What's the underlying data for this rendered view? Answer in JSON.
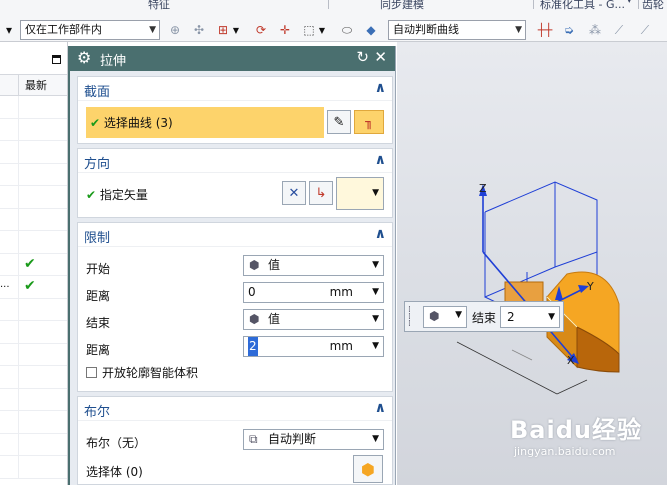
{
  "ribbon": {
    "groups": [
      "特征",
      "同步建模",
      "标准化工具 - G...",
      "齿轮"
    ],
    "filter_dropdown": "仅在工作部件内",
    "curve_rule_dropdown": "自动判断曲线"
  },
  "navigator": {
    "column_header": "最新",
    "rows": [
      {
        "label": "",
        "latest": false
      },
      {
        "label": "",
        "latest": false
      },
      {
        "label": "",
        "latest": false
      },
      {
        "label": "",
        "latest": false
      },
      {
        "label": "",
        "latest": false
      },
      {
        "label": "",
        "latest": false
      },
      {
        "label": "",
        "latest": false
      },
      {
        "label": "",
        "latest": true
      },
      {
        "label": "...",
        "latest": true
      },
      {
        "label": "",
        "latest": false
      },
      {
        "label": "",
        "latest": false
      },
      {
        "label": "",
        "latest": false
      },
      {
        "label": "",
        "latest": false
      },
      {
        "label": "",
        "latest": false
      },
      {
        "label": "",
        "latest": false
      },
      {
        "label": "",
        "latest": false
      },
      {
        "label": "",
        "latest": false
      }
    ],
    "check_glyph": "✔"
  },
  "dialog": {
    "title": "拉伸",
    "section": {
      "title": "截面",
      "select_curve": "选择曲线 (3)"
    },
    "direction": {
      "title": "方向",
      "specify_vector": "指定矢量"
    },
    "limits": {
      "title": "限制",
      "start_label": "开始",
      "start_option": "值",
      "start_distance_label": "距离",
      "start_distance": "0",
      "start_unit": "mm",
      "end_label": "结束",
      "end_option": "值",
      "end_distance_label": "距离",
      "end_distance": "2",
      "end_unit": "mm",
      "open_profile": "开放轮廓智能体积"
    },
    "boolean": {
      "title": "布尔",
      "boolean_label": "布尔（无）",
      "boolean_option": "自动判断",
      "select_body": "选择体 (0)"
    }
  },
  "viewport": {
    "axis_z": "Z",
    "axis_y": "Y",
    "axis_x": "X",
    "handle_end_label": "结束",
    "handle_end_value": "2",
    "watermark_brand": "Baidu经验",
    "watermark_url": "jingyan.baidu.com"
  },
  "colors": {
    "dialog_title_bg": "#4a6f6f",
    "section_title": "#1f4f8f",
    "selection_highlight": "#fdd36b",
    "model_orange": "#f5a623",
    "check_green": "#1a9a1a"
  }
}
